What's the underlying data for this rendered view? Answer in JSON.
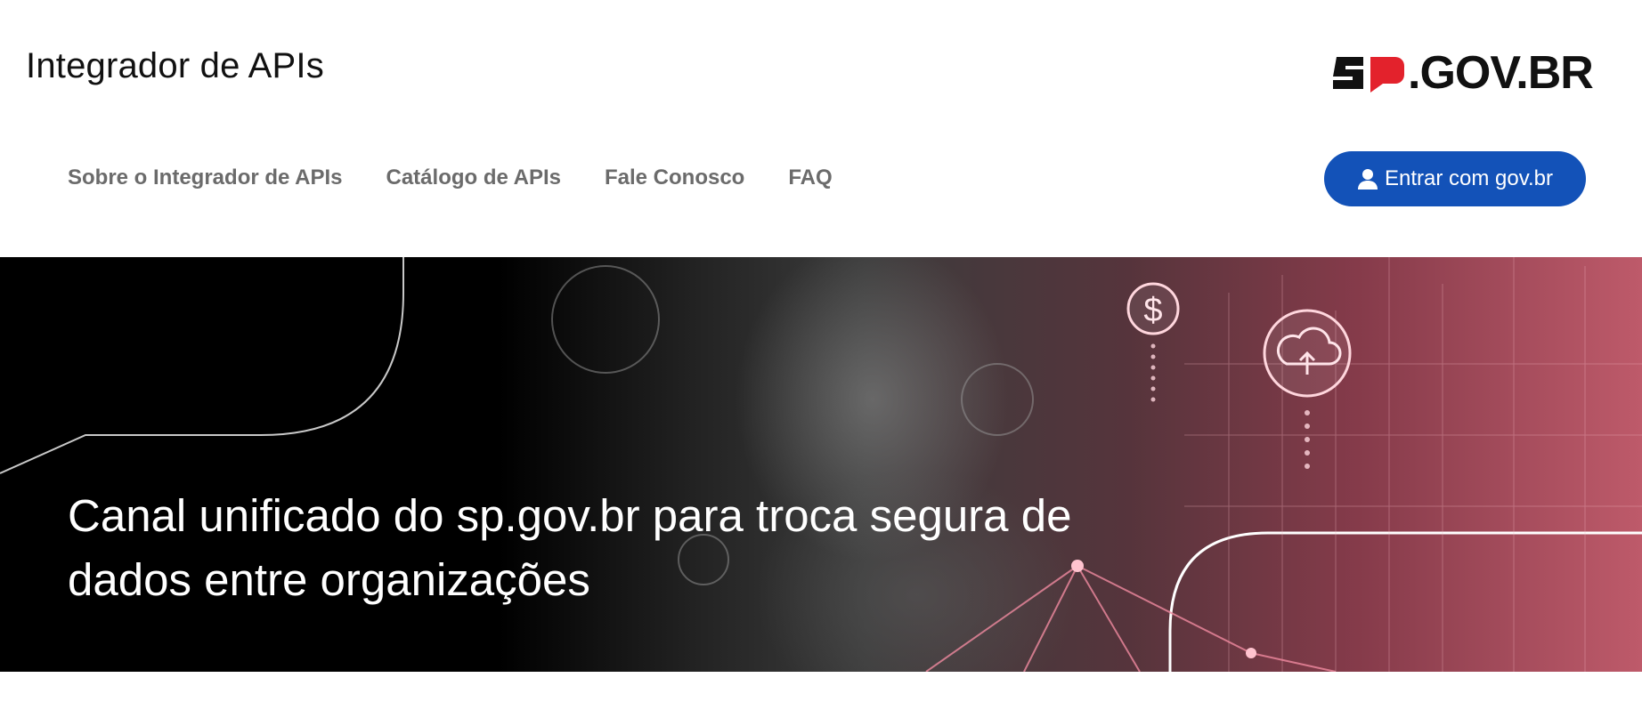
{
  "header": {
    "site_title": "Integrador de APIs",
    "logo_text": ".GOV.BR",
    "logo_prefix": "SP",
    "logo_color": "#e3222c"
  },
  "nav": {
    "items": [
      {
        "label": "Sobre o Integrador de APIs"
      },
      {
        "label": "Catálogo de APIs"
      },
      {
        "label": "Fale Conosco"
      },
      {
        "label": "FAQ"
      }
    ]
  },
  "login": {
    "label": "Entrar com gov.br",
    "icon": "user-icon",
    "color": "#1352b8"
  },
  "hero": {
    "heading": "Canal unificado do sp.gov.br para troca segura de dados entre organizações",
    "icons": [
      "dollar-icon",
      "cloud-upload-icon"
    ]
  }
}
